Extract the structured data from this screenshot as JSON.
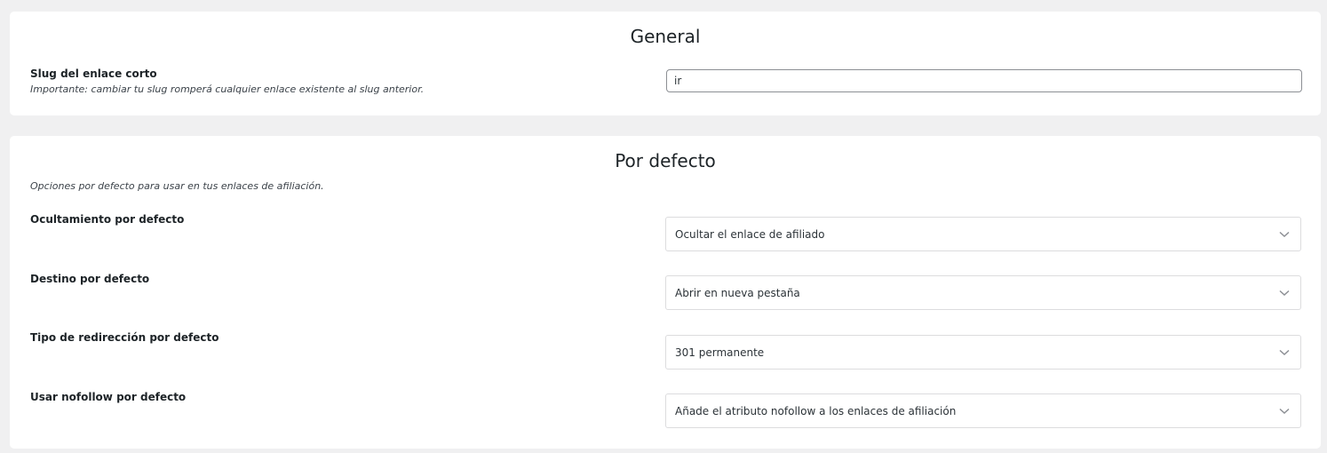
{
  "general": {
    "title": "General",
    "slug": {
      "label": "Slug del enlace corto",
      "note": "Importante: cambiar tu slug romperá cualquier enlace existente al slug anterior.",
      "value": "ir"
    }
  },
  "defaults": {
    "title": "Por defecto",
    "description": "Opciones por defecto para usar en tus enlaces de afiliación.",
    "cloaking": {
      "label": "Ocultamiento por defecto",
      "value": "Ocultar el enlace de afiliado"
    },
    "target": {
      "label": "Destino por defecto",
      "value": "Abrir en nueva pestaña"
    },
    "redirect": {
      "label": "Tipo de redirección por defecto",
      "value": "301 permanente"
    },
    "nofollow": {
      "label": "Usar nofollow por defecto",
      "value": "Añade el atributo nofollow a los enlaces de afiliación"
    }
  },
  "icons": {
    "select_arrow": "chevron-down-icon"
  },
  "colors": {
    "background": "#f0f0f1",
    "card": "#ffffff",
    "text": "#1d2327",
    "input_border": "#8c8f94",
    "select_border": "#dcdcde",
    "chevron": "#8c8f94"
  }
}
